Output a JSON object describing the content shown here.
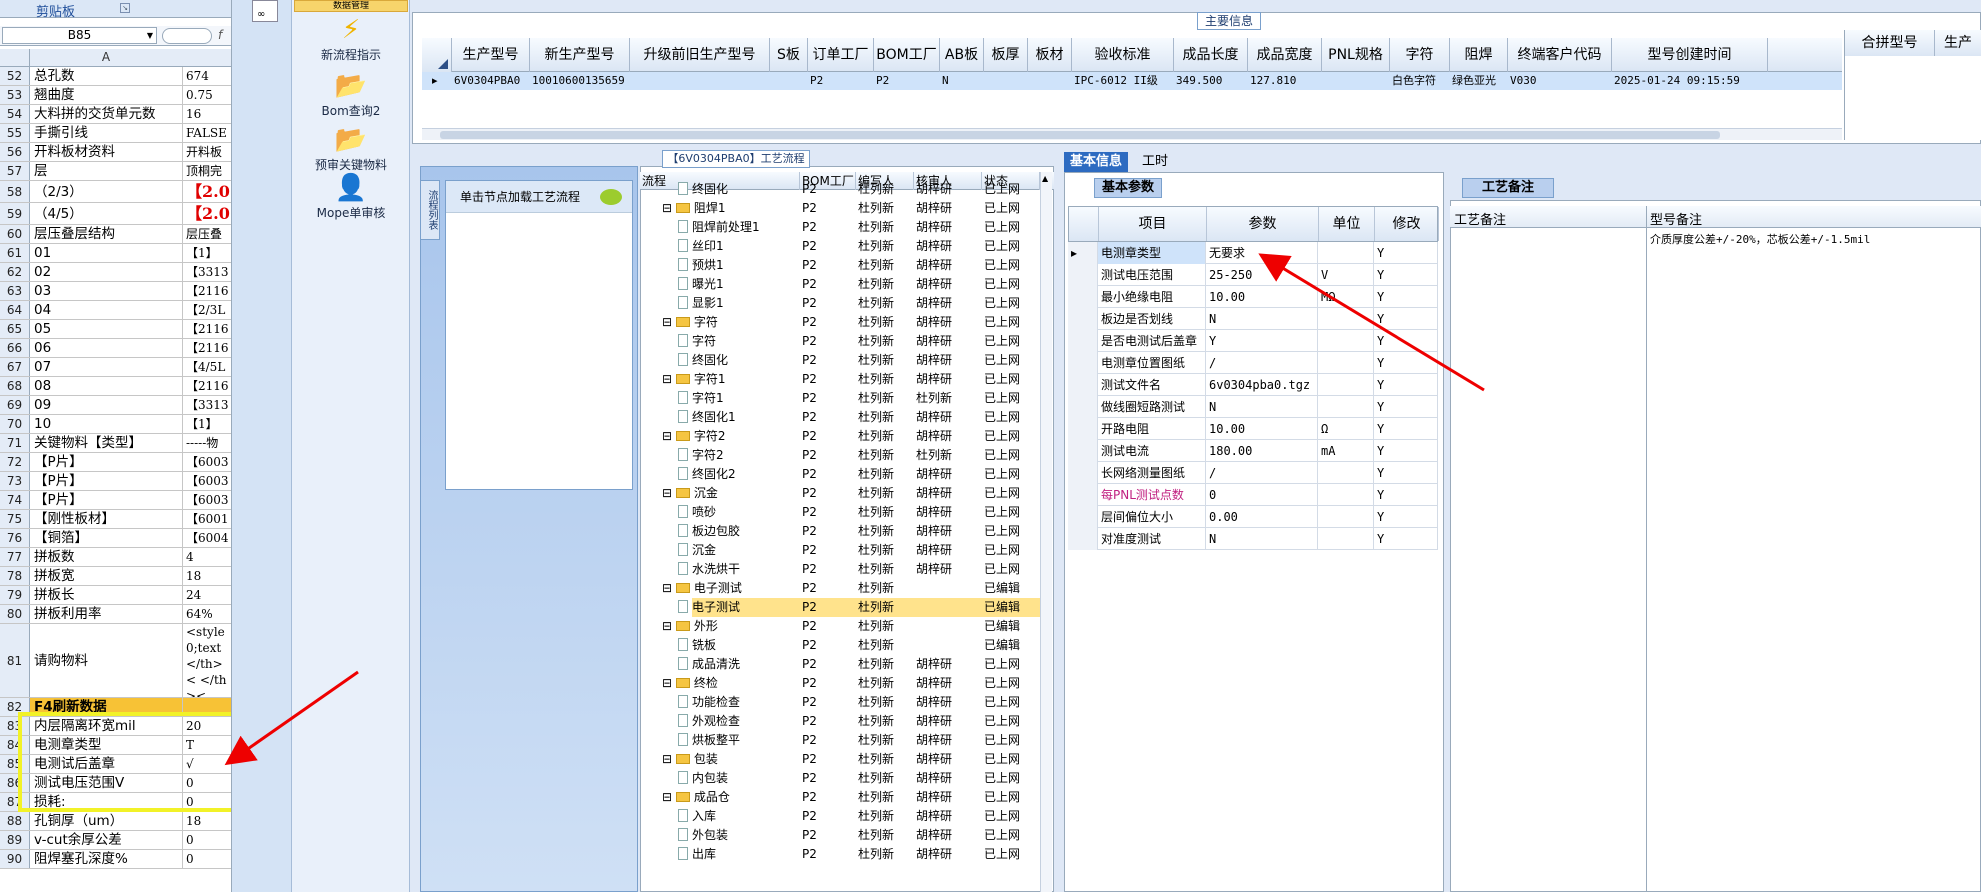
{
  "excel": {
    "clipboard_label": "剪贴板",
    "name_box": "B85",
    "column_header": "A",
    "rows": [
      {
        "n": "52",
        "a": "总孔数",
        "b": "674"
      },
      {
        "n": "53",
        "a": "翘曲度",
        "b": "0.75"
      },
      {
        "n": "54",
        "a": "大料拼的交货单元数",
        "b": "16"
      },
      {
        "n": "55",
        "a": "手撕引线",
        "b": "FALSE"
      },
      {
        "n": "56",
        "a": "开料板材资料",
        "b": "开料板"
      },
      {
        "n": "57",
        "a": "层",
        "b": "顶桐完"
      },
      {
        "n": "58",
        "a": "（2/3）",
        "b": "【2.0"
      },
      {
        "n": "59",
        "a": "（4/5）",
        "b": "【2.0"
      },
      {
        "n": "60",
        "a": "层压叠层结构",
        "b": "层压叠"
      },
      {
        "n": "61",
        "a": "01",
        "b": "【1】"
      },
      {
        "n": "62",
        "a": "02",
        "b": "【3313"
      },
      {
        "n": "63",
        "a": "03",
        "b": "【2116"
      },
      {
        "n": "64",
        "a": "04",
        "b": "【2/3L"
      },
      {
        "n": "65",
        "a": "05",
        "b": "【2116"
      },
      {
        "n": "66",
        "a": "06",
        "b": "【2116"
      },
      {
        "n": "67",
        "a": "07",
        "b": "【4/5L"
      },
      {
        "n": "68",
        "a": "08",
        "b": "【2116"
      },
      {
        "n": "69",
        "a": "09",
        "b": "【3313"
      },
      {
        "n": "70",
        "a": "10",
        "b": "【1】"
      },
      {
        "n": "71",
        "a": "关键物料【类型】",
        "b": "-----物"
      },
      {
        "n": "72",
        "a": "【P片】",
        "b": "【6003"
      },
      {
        "n": "73",
        "a": "【P片】",
        "b": "【6003"
      },
      {
        "n": "74",
        "a": "【P片】",
        "b": "【6003"
      },
      {
        "n": "75",
        "a": "【刚性板材】",
        "b": "【6001"
      },
      {
        "n": "76",
        "a": "【铜箔】",
        "b": "【6004"
      },
      {
        "n": "77",
        "a": "拼板数",
        "b": "4"
      },
      {
        "n": "78",
        "a": "拼板宽",
        "b": "18"
      },
      {
        "n": "79",
        "a": "拼板长",
        "b": "24"
      },
      {
        "n": "80",
        "a": "拼板利用率",
        "b": "64%"
      },
      {
        "n": "81",
        "a": "请购物料",
        "b": "<style 0;text </th>< </th><"
      },
      {
        "n": "82",
        "a": "F4刷新数据",
        "b": ""
      },
      {
        "n": "83",
        "a": "内层隔离环宽mil",
        "b": "20"
      },
      {
        "n": "84",
        "a": "电测章类型",
        "b": "T"
      },
      {
        "n": "85",
        "a": "电测试后盖章",
        "b": "√"
      },
      {
        "n": "86",
        "a": "测试电压范围V",
        "b": "0"
      },
      {
        "n": "87",
        "a": "损耗:",
        "b": "0"
      },
      {
        "n": "88",
        "a": "孔铜厚（um）",
        "b": "18"
      },
      {
        "n": "89",
        "a": "v-cut余厚公差",
        "b": "0"
      },
      {
        "n": "90",
        "a": "阻焊塞孔深度%",
        "b": "0"
      }
    ]
  },
  "nav": {
    "top_partial": "数据管理",
    "items": [
      {
        "label": "新流程指示",
        "icon": "lightning-icon"
      },
      {
        "label": "Bom查询2",
        "icon": "folder-icon"
      },
      {
        "label": "预审关键物料",
        "icon": "folder-icon"
      },
      {
        "label": "Mope单审核",
        "icon": "user-icon"
      }
    ]
  },
  "main_info": {
    "label": "主要信息",
    "headers": [
      "生产型号",
      "新生产型号",
      "升级前旧生产型号",
      "S板",
      "订单工厂",
      "BOM工厂",
      "AB板",
      "板厚",
      "板材",
      "验收标准",
      "成品长度",
      "成品宽度",
      "PNL规格",
      "字符",
      "阻焊",
      "终端客户代码",
      "型号创建时间"
    ],
    "row": [
      "6V0304PBA0",
      "10010600135659",
      "",
      "",
      "P2",
      "P2",
      "N",
      "",
      "",
      "IPC-6012 II级",
      "349.500",
      "127.810",
      "",
      "白色字符",
      "绿色亚光",
      "V030",
      "2025-01-24 09:15:59"
    ],
    "right_headers": [
      "合拼型号",
      "生产"
    ]
  },
  "process": {
    "label": "【6V0304PBA0】工艺流程",
    "load_hint": "单击节点加载工艺流程",
    "side_tab": "流程列表",
    "headers": [
      "流程",
      "BOM工厂",
      "编写人",
      "核审人",
      "状态"
    ],
    "rows": [
      {
        "lvl": 2,
        "name": "终固化",
        "f": "P2",
        "w": "杜列新",
        "r": "胡梓研",
        "s": "已上网"
      },
      {
        "lvl": 1,
        "name": "阻焊1",
        "f": "P2",
        "w": "杜列新",
        "r": "胡梓研",
        "s": "已上网"
      },
      {
        "lvl": 2,
        "name": "阻焊前处理1",
        "f": "P2",
        "w": "杜列新",
        "r": "胡梓研",
        "s": "已上网"
      },
      {
        "lvl": 2,
        "name": "丝印1",
        "f": "P2",
        "w": "杜列新",
        "r": "胡梓研",
        "s": "已上网"
      },
      {
        "lvl": 2,
        "name": "预烘1",
        "f": "P2",
        "w": "杜列新",
        "r": "胡梓研",
        "s": "已上网"
      },
      {
        "lvl": 2,
        "name": "曝光1",
        "f": "P2",
        "w": "杜列新",
        "r": "胡梓研",
        "s": "已上网"
      },
      {
        "lvl": 2,
        "name": "显影1",
        "f": "P2",
        "w": "杜列新",
        "r": "胡梓研",
        "s": "已上网"
      },
      {
        "lvl": 1,
        "name": "字符",
        "f": "P2",
        "w": "杜列新",
        "r": "胡梓研",
        "s": "已上网"
      },
      {
        "lvl": 2,
        "name": "字符",
        "f": "P2",
        "w": "杜列新",
        "r": "胡梓研",
        "s": "已上网"
      },
      {
        "lvl": 2,
        "name": "终固化",
        "f": "P2",
        "w": "杜列新",
        "r": "胡梓研",
        "s": "已上网"
      },
      {
        "lvl": 1,
        "name": "字符1",
        "f": "P2",
        "w": "杜列新",
        "r": "胡梓研",
        "s": "已上网"
      },
      {
        "lvl": 2,
        "name": "字符1",
        "f": "P2",
        "w": "杜列新",
        "r": "杜列新",
        "s": "已上网"
      },
      {
        "lvl": 2,
        "name": "终固化1",
        "f": "P2",
        "w": "杜列新",
        "r": "胡梓研",
        "s": "已上网"
      },
      {
        "lvl": 1,
        "name": "字符2",
        "f": "P2",
        "w": "杜列新",
        "r": "胡梓研",
        "s": "已上网"
      },
      {
        "lvl": 2,
        "name": "字符2",
        "f": "P2",
        "w": "杜列新",
        "r": "杜列新",
        "s": "已上网"
      },
      {
        "lvl": 2,
        "name": "终固化2",
        "f": "P2",
        "w": "杜列新",
        "r": "胡梓研",
        "s": "已上网"
      },
      {
        "lvl": 1,
        "name": "沉金",
        "f": "P2",
        "w": "杜列新",
        "r": "胡梓研",
        "s": "已上网"
      },
      {
        "lvl": 2,
        "name": "喷砂",
        "f": "P2",
        "w": "杜列新",
        "r": "胡梓研",
        "s": "已上网"
      },
      {
        "lvl": 2,
        "name": "板边包胶",
        "f": "P2",
        "w": "杜列新",
        "r": "胡梓研",
        "s": "已上网"
      },
      {
        "lvl": 2,
        "name": "沉金",
        "f": "P2",
        "w": "杜列新",
        "r": "胡梓研",
        "s": "已上网"
      },
      {
        "lvl": 2,
        "name": "水洗烘干",
        "f": "P2",
        "w": "杜列新",
        "r": "胡梓研",
        "s": "已上网"
      },
      {
        "lvl": 1,
        "name": "电子测试",
        "f": "P2",
        "w": "杜列新",
        "r": "",
        "s": "已编辑"
      },
      {
        "lvl": 2,
        "name": "电子测试",
        "f": "P2",
        "w": "杜列新",
        "r": "",
        "s": "已编辑"
      },
      {
        "lvl": 1,
        "name": "外形",
        "f": "P2",
        "w": "杜列新",
        "r": "",
        "s": "已编辑"
      },
      {
        "lvl": 2,
        "name": "铣板",
        "f": "P2",
        "w": "杜列新",
        "r": "",
        "s": "已编辑"
      },
      {
        "lvl": 2,
        "name": "成品清洗",
        "f": "P2",
        "w": "杜列新",
        "r": "胡梓研",
        "s": "已上网"
      },
      {
        "lvl": 1,
        "name": "终检",
        "f": "P2",
        "w": "杜列新",
        "r": "胡梓研",
        "s": "已上网"
      },
      {
        "lvl": 2,
        "name": "功能检查",
        "f": "P2",
        "w": "杜列新",
        "r": "胡梓研",
        "s": "已上网"
      },
      {
        "lvl": 2,
        "name": "外观检查",
        "f": "P2",
        "w": "杜列新",
        "r": "胡梓研",
        "s": "已上网"
      },
      {
        "lvl": 2,
        "name": "烘板整平",
        "f": "P2",
        "w": "杜列新",
        "r": "胡梓研",
        "s": "已上网"
      },
      {
        "lvl": 1,
        "name": "包装",
        "f": "P2",
        "w": "杜列新",
        "r": "胡梓研",
        "s": "已上网"
      },
      {
        "lvl": 2,
        "name": "内包装",
        "f": "P2",
        "w": "杜列新",
        "r": "胡梓研",
        "s": "已上网"
      },
      {
        "lvl": 1,
        "name": "成品仓",
        "f": "P2",
        "w": "杜列新",
        "r": "胡梓研",
        "s": "已上网"
      },
      {
        "lvl": 2,
        "name": "入库",
        "f": "P2",
        "w": "杜列新",
        "r": "胡梓研",
        "s": "已上网"
      },
      {
        "lvl": 2,
        "name": "外包装",
        "f": "P2",
        "w": "杜列新",
        "r": "胡梓研",
        "s": "已上网"
      },
      {
        "lvl": 2,
        "name": "出库",
        "f": "P2",
        "w": "杜列新",
        "r": "胡梓研",
        "s": "已上网"
      }
    ]
  },
  "info": {
    "tabs": [
      "基本信息",
      "工时"
    ],
    "sub_tab": "基本参数",
    "headers": [
      "项目",
      "参数",
      "单位",
      "修改"
    ],
    "rows": [
      {
        "item": "电测章类型",
        "val": "无要求",
        "unit": "",
        "mod": "Y"
      },
      {
        "item": "测试电压范围",
        "val": "25-250",
        "unit": "V",
        "mod": "Y"
      },
      {
        "item": "最小绝缘电阻",
        "val": "10.00",
        "unit": "MΩ",
        "mod": "Y"
      },
      {
        "item": "板边是否划线",
        "val": "N",
        "unit": "",
        "mod": "Y"
      },
      {
        "item": "是否电测试后盖章",
        "val": "Y",
        "unit": "",
        "mod": "Y"
      },
      {
        "item": "电测章位置图纸",
        "val": "/",
        "unit": "",
        "mod": "Y"
      },
      {
        "item": "测试文件名",
        "val": "6v0304pba0.tgz",
        "unit": "",
        "mod": "Y"
      },
      {
        "item": "做线圈短路测试",
        "val": "N",
        "unit": "",
        "mod": "Y"
      },
      {
        "item": "开路电阻",
        "val": "10.00",
        "unit": "Ω",
        "mod": "Y"
      },
      {
        "item": "测试电流",
        "val": "180.00",
        "unit": "mA",
        "mod": "Y"
      },
      {
        "item": "长网络测量图纸",
        "val": "/",
        "unit": "",
        "mod": "Y"
      },
      {
        "item": "每PNL测试点数",
        "val": "0",
        "unit": "",
        "mod": "Y"
      },
      {
        "item": "层间偏位大小",
        "val": "0.00",
        "unit": "",
        "mod": "Y"
      },
      {
        "item": "对准度测试",
        "val": "N",
        "unit": "",
        "mod": "Y"
      }
    ]
  },
  "remarks": {
    "tab": "工艺备注",
    "headers": [
      "工艺备注",
      "型号备注"
    ],
    "model_note": "介质厚度公差+/-20%，芯板公差+/-1.5mil"
  }
}
